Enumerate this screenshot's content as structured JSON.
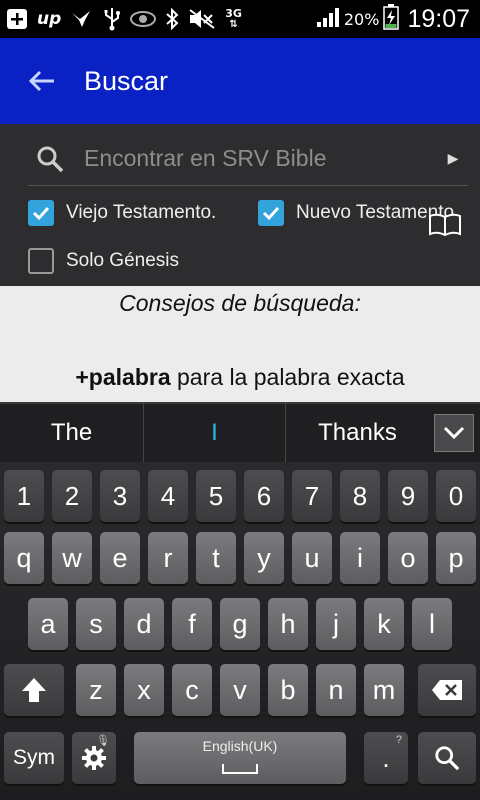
{
  "status_bar": {
    "icons": [
      "add-box-icon",
      "up-icon",
      "bird-icon",
      "usb-icon",
      "eye-icon",
      "bluetooth-icon",
      "mute-icon",
      "network-3g-icon",
      "signal-icon"
    ],
    "network_label": "3G",
    "up_label": "up",
    "battery_percent": "20%",
    "time": "19:07"
  },
  "app_bar": {
    "title": "Buscar",
    "color": "#0a22c4"
  },
  "search": {
    "placeholder": "Encontrar en SRV Bible",
    "value": ""
  },
  "filters": {
    "old_testament": {
      "label": "Viejo Testamento.",
      "checked": true
    },
    "new_testament": {
      "label": "Nuevo Testamento.",
      "checked": true
    },
    "genesis_only": {
      "label": "Solo Génesis",
      "checked": false
    }
  },
  "tips": {
    "title": "Consejos de búsqueda:",
    "line1_bold": "+palabra",
    "line1_rest": " para la palabra exacta"
  },
  "suggestions": [
    "The",
    "I",
    "Thanks"
  ],
  "keyboard": {
    "row_numbers": [
      "1",
      "2",
      "3",
      "4",
      "5",
      "6",
      "7",
      "8",
      "9",
      "0"
    ],
    "row1": [
      "q",
      "w",
      "e",
      "r",
      "t",
      "y",
      "u",
      "i",
      "o",
      "p"
    ],
    "row2": [
      "a",
      "s",
      "d",
      "f",
      "g",
      "h",
      "j",
      "k",
      "l"
    ],
    "row3": [
      "z",
      "x",
      "c",
      "v",
      "b",
      "n",
      "m"
    ],
    "sym_label": "Sym",
    "space_label": "English(UK)",
    "period_label": ".",
    "accent_color": "#33b5e5"
  }
}
